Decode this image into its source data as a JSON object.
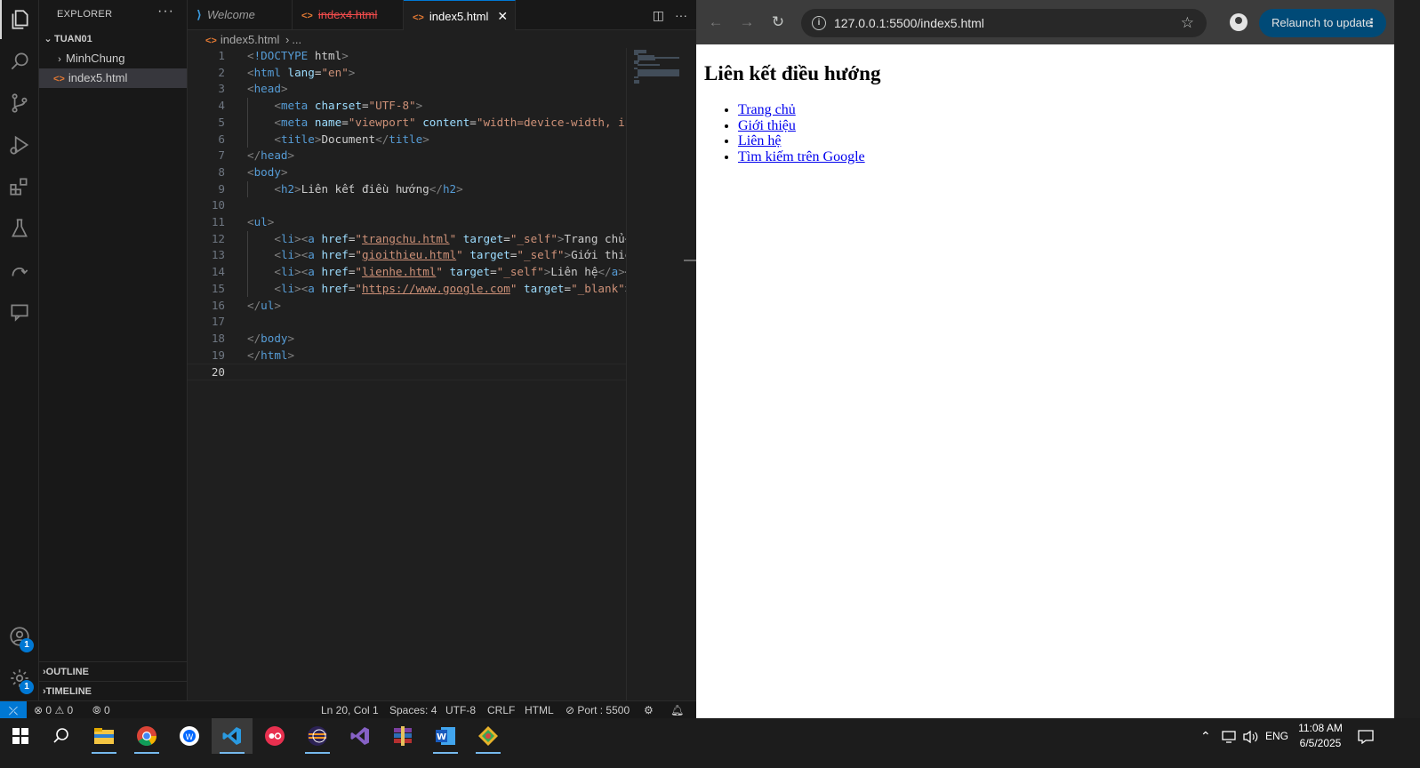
{
  "vscode": {
    "explorer_title": "EXPLORER",
    "explorer_menu": "···",
    "workspace": "TUAN01",
    "tree": [
      {
        "label": "MinhChung",
        "type": "folder"
      },
      {
        "label": "index5.html",
        "type": "html"
      }
    ],
    "sections": {
      "outline": "OUTLINE",
      "timeline": "TIMELINE"
    },
    "account_badge": "1",
    "settings_badge": "1",
    "tabs": [
      {
        "label": "Welcome",
        "icon": "vscode-icon"
      },
      {
        "label": "index4.html",
        "icon": "html-icon",
        "state": "deleted"
      },
      {
        "label": "index5.html",
        "icon": "html-icon",
        "state": "active",
        "close": "✕"
      }
    ],
    "breadcrumb": {
      "file": "index5.html",
      "sep": "›",
      "more": "..."
    },
    "line_numbers": [
      "1",
      "2",
      "3",
      "4",
      "5",
      "6",
      "7",
      "8",
      "9",
      "10",
      "11",
      "12",
      "13",
      "14",
      "15",
      "16",
      "17",
      "18",
      "19",
      "20"
    ],
    "code_lines": [
      "<!DOCTYPE html>",
      "<html lang=\"en\">",
      "<head>",
      "    <meta charset=\"UTF-8\">",
      "    <meta name=\"viewport\" content=\"width=device-width, in",
      "    <title>Document</title>",
      "</head>",
      "<body>",
      "    <h2>Liên kết điều hướng</h2>",
      "",
      "<ul>",
      "    <li><a href=\"trangchu.html\" target=\"_self\">Trang chủ<",
      "    <li><a href=\"gioithieu.html\" target=\"_self\">Giới thiệ",
      "    <li><a href=\"lienhe.html\" target=\"_self\">Liên hệ</a><",
      "    <li><a href=\"https://www.google.com\" target=\"_blank\">",
      "</ul>",
      "",
      "</body>",
      "</html>",
      ""
    ],
    "status": {
      "errors": "0",
      "warnings": "0",
      "ports": "0",
      "position": "Ln 20, Col 1",
      "spaces": "Spaces: 4",
      "encoding": "UTF-8",
      "eol": "CRLF",
      "language": "HTML",
      "port": "Port : 5500"
    }
  },
  "browser": {
    "url": "127.0.0.1:5500/index5.html",
    "relaunch": "Relaunch to update",
    "page_heading": "Liên kết điều hướng",
    "links": [
      "Trang chủ",
      "Giới thiệu",
      "Liên hệ",
      "Tìm kiếm trên Google"
    ]
  },
  "taskbar": {
    "lang": "ENG",
    "time": "11:08 AM",
    "date": "6/5/2025"
  },
  "colors": {
    "accent": "#0078d4",
    "link": "#0000ee",
    "tag": "#569cd6",
    "attr": "#9cdcfe",
    "string": "#ce9178"
  }
}
